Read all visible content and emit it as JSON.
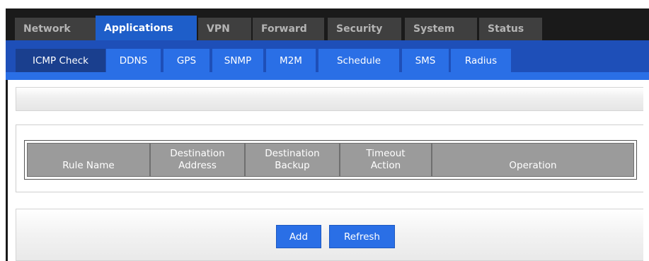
{
  "main_nav": {
    "tabs": [
      {
        "label": "Network",
        "active": false
      },
      {
        "label": "Applications",
        "active": true
      },
      {
        "label": "VPN",
        "active": false
      },
      {
        "label": "Forward",
        "active": false
      },
      {
        "label": "Security",
        "active": false
      },
      {
        "label": "System",
        "active": false
      },
      {
        "label": "Status",
        "active": false
      }
    ]
  },
  "sub_nav": {
    "tabs": [
      {
        "label": "ICMP Check",
        "active": true
      },
      {
        "label": "DDNS",
        "active": false
      },
      {
        "label": "GPS",
        "active": false
      },
      {
        "label": "SNMP",
        "active": false
      },
      {
        "label": "M2M",
        "active": false
      },
      {
        "label": "Schedule",
        "active": false
      },
      {
        "label": "SMS",
        "active": false
      },
      {
        "label": "Radius",
        "active": false
      }
    ]
  },
  "table": {
    "columns": [
      {
        "line1": "",
        "line2": "Rule Name"
      },
      {
        "line1": "Destination",
        "line2": "Address"
      },
      {
        "line1": "Destination",
        "line2": "Backup"
      },
      {
        "line1": "Timeout",
        "line2": "Action"
      },
      {
        "line1": "",
        "line2": "Operation"
      }
    ],
    "rows": []
  },
  "actions": {
    "add_label": "Add",
    "refresh_label": "Refresh"
  },
  "colors": {
    "nav_bg": "#1a1a1a",
    "tab_inactive": "#3f3f3f",
    "accent_blue": "#2a6fe6",
    "sub_nav_bg": "#1e4fb8",
    "active_sub_tab": "#1a3f8e",
    "header_gray": "#9b9b9b"
  }
}
